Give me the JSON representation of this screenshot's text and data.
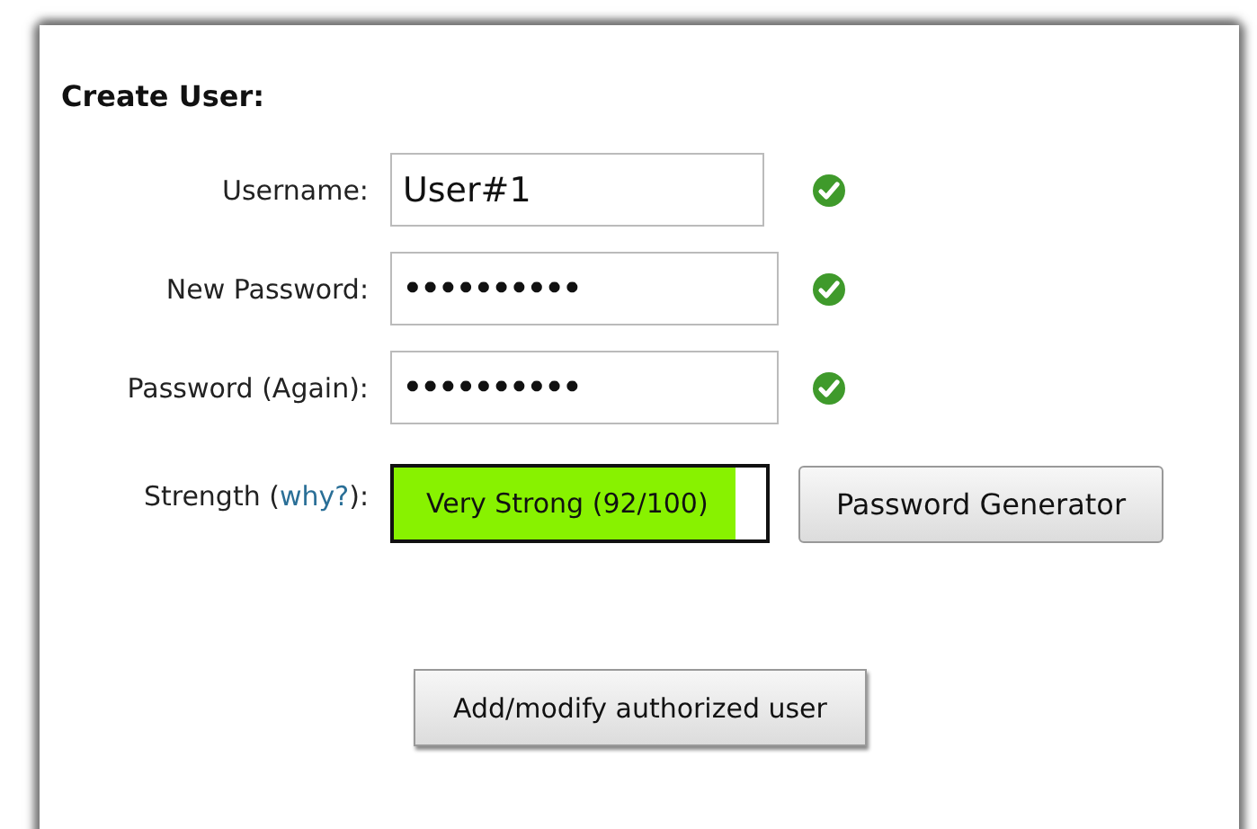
{
  "title": "Create User:",
  "fields": [
    {
      "label": "Username:",
      "value": "User#1",
      "valid": true,
      "kind": "text"
    },
    {
      "label": "New Password:",
      "value": "••••••••••",
      "valid": true,
      "kind": "password"
    },
    {
      "label": "Password (Again):",
      "value": "••••••••••",
      "valid": true,
      "kind": "password"
    }
  ],
  "strength": {
    "label_before": "Strength (",
    "link": "why?",
    "label_after": "):",
    "reading": "Very Strong (92/100)",
    "level": 0.92
  },
  "buttons": {
    "generator": "Password Generator",
    "submit": "Add/modify authorized user"
  }
}
